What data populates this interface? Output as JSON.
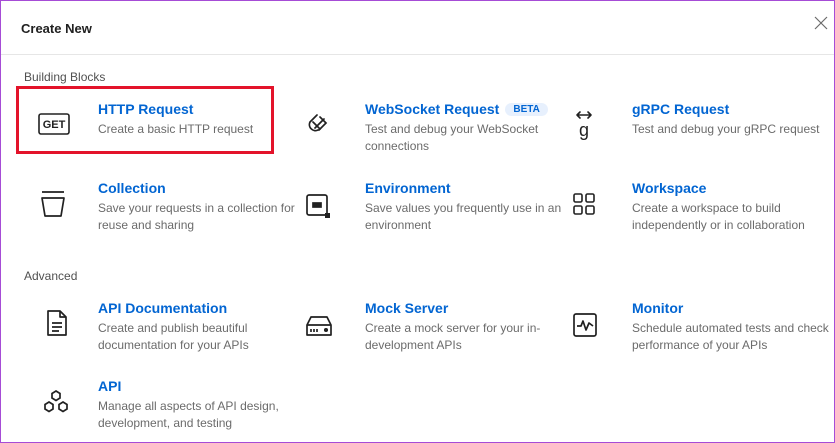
{
  "dialog": {
    "title": "Create New"
  },
  "sections": {
    "building_blocks": "Building Blocks",
    "advanced": "Advanced"
  },
  "items": {
    "http": {
      "name": "HTTP Request",
      "desc": "Create a basic HTTP request",
      "icon": "GET"
    },
    "websocket": {
      "name": "WebSocket Request",
      "badge": "BETA",
      "desc": "Test and debug your WebSocket connections"
    },
    "grpc": {
      "name": "gRPC Request",
      "desc": "Test and debug your gRPC request"
    },
    "collection": {
      "name": "Collection",
      "desc": "Save your requests in a collection for reuse and sharing"
    },
    "environment": {
      "name": "Environment",
      "desc": "Save values you frequently use in an environment"
    },
    "workspace": {
      "name": "Workspace",
      "desc": "Create a workspace to build independently or in collaboration"
    },
    "api_docs": {
      "name": "API Documentation",
      "desc": "Create and publish beautiful documentation for your APIs"
    },
    "mock": {
      "name": "Mock Server",
      "desc": "Create a mock server for your in-development APIs"
    },
    "monitor": {
      "name": "Monitor",
      "desc": "Schedule automated tests and check performance of your APIs"
    },
    "api": {
      "name": "API",
      "desc": "Manage all aspects of API design, development, and testing"
    }
  },
  "colors": {
    "accent": "#0265d2",
    "highlight": "#e3132a",
    "border": "#a64cd6"
  }
}
